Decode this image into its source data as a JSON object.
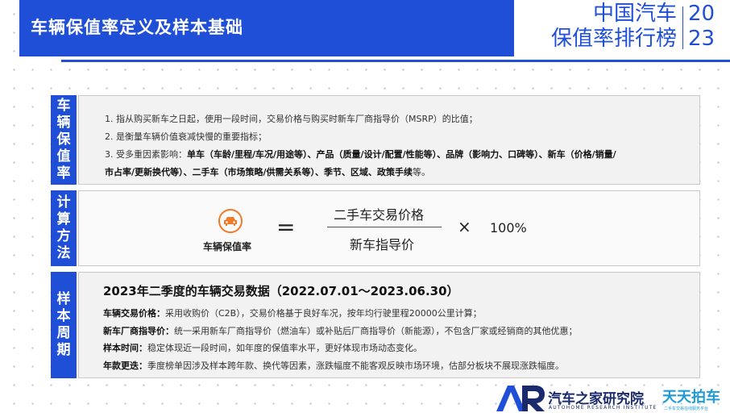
{
  "header": {
    "title": "车辆保值率定义及样本基础",
    "brand_title_line1": "中国汽车",
    "brand_title_line2": "保值率排行榜",
    "brand_year_line1": "20",
    "brand_year_line2": "23"
  },
  "sections": {
    "definition": {
      "label": [
        "车",
        "辆",
        "保",
        "值",
        "率"
      ],
      "item1": "1. 指从购买新车之日起，使用一段时间，交易价格与购买时新车厂商指导价（MSRP）的比值；",
      "item2": "2. 是衡量车辆价值衰减快慢的重要指标；",
      "item3_prefix": "3. 受多重因素影响：",
      "item3_bold": "单车（车龄/里程/车况/用途等）、产品（质量/设计/配置/性能等）、品牌（影响力、口碑等）、新车（价格/销量/",
      "item3_line2_bold": "市占率/更新换代等）、二手车（市场策略/供需关系等）、季节、区域、政策手续",
      "item3_suffix": "等。"
    },
    "calculation": {
      "label": [
        "计",
        "算",
        "方",
        "法"
      ],
      "icon_label": "车辆保值率",
      "equals": "=",
      "numerator": "二手车交易价格",
      "denominator": "新车指导价",
      "times": "×",
      "percent": "100%"
    },
    "sample": {
      "label": [
        "样",
        "本",
        "周",
        "期"
      ],
      "title": "2023年二季度的车辆交易数据（2022.07.01～2023.06.30）",
      "lines": [
        {
          "key": "车辆交易价格：",
          "text": "采用收购价（C2B），交易价格基于良好车况，按年均行驶里程20000公里计算；"
        },
        {
          "key": "新车厂商指导价：",
          "text": "统一采用新车厂商指导价（燃油车）或补贴后厂商指导价（新能源），不包含厂家或经销商的其他优惠；"
        },
        {
          "key": "样本时间：",
          "text": "稳定体现近一段时间，如年度的保值率水平，更好体现市场动态变化。"
        },
        {
          "key": "年款更迭：",
          "text": "季度榜单因涉及样本跨年款、换代等因素，涨跌幅度不能客观反映市场环境，估部分板块不展现涨跌幅度。"
        }
      ]
    }
  },
  "footer": {
    "logo_cn": "汽车之家研究院",
    "logo_en": "AUTOHOME RESEARCH INSTITUTE",
    "partner": "天天拍车",
    "partner_sub": "二手车交易在线服务平台"
  },
  "colors": {
    "primary": "#1f4fd6",
    "accent": "#f07a25",
    "panel_bg": "#f2f2f2"
  }
}
